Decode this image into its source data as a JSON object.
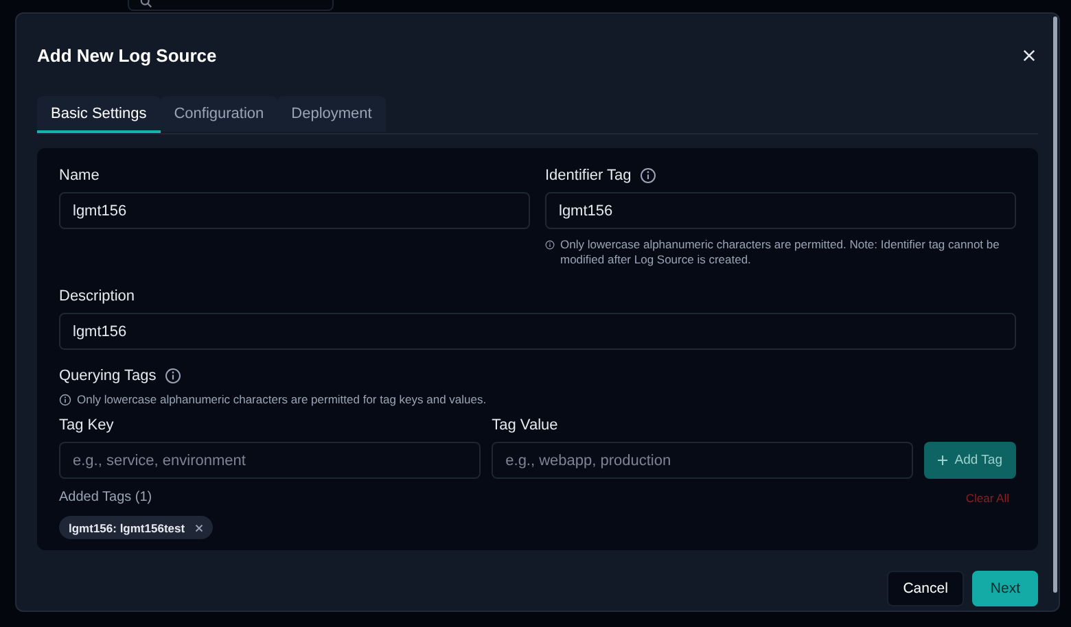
{
  "dialog": {
    "title": "Add New Log Source",
    "tabs": [
      {
        "label": "Basic Settings",
        "selected": true
      },
      {
        "label": "Configuration",
        "selected": false
      },
      {
        "label": "Deployment",
        "selected": false
      }
    ],
    "name": {
      "label": "Name",
      "value": "lgmt156"
    },
    "identifier_tag": {
      "label": "Identifier Tag",
      "value": "lgmt156",
      "hint": "Only lowercase alphanumeric characters are permitted. Note: Identifier tag cannot be modified after Log Source is created."
    },
    "description": {
      "label": "Description",
      "value": "lgmt156"
    },
    "querying_tags": {
      "label": "Querying Tags",
      "hint": "Only lowercase alphanumeric characters are permitted for tag keys and values.",
      "tag_key": {
        "label": "Tag Key",
        "placeholder": "e.g., service, environment"
      },
      "tag_value": {
        "label": "Tag Value",
        "placeholder": "e.g., webapp, production"
      },
      "add_button": "Add Tag",
      "added_label": "Added Tags (1)",
      "clear_all": "Clear All",
      "tags": [
        "lgmt156: lgmt156test"
      ]
    },
    "buttons": [
      "Cancel",
      "Next"
    ]
  }
}
